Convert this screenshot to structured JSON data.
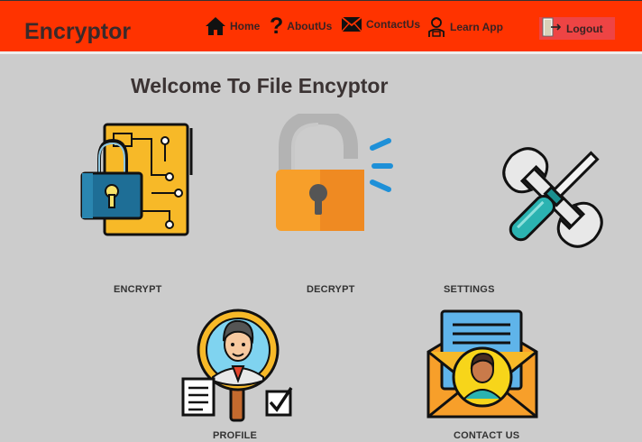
{
  "app": {
    "brand": "Encryptor"
  },
  "nav": [
    {
      "label": "Home",
      "icon": "home-icon"
    },
    {
      "label": "AboutUs",
      "icon": "question-icon"
    },
    {
      "label": "ContactUs",
      "icon": "mail-icon"
    },
    {
      "label": "Learn App",
      "icon": "learner-icon"
    }
  ],
  "logout": {
    "label": "Logout",
    "icon": "exit-door-icon"
  },
  "main": {
    "title": "Welcome To File Encyptor",
    "tiles": [
      {
        "label": "ENCRYPT",
        "icon": "padlock-circuit-icon"
      },
      {
        "label": "DECRYPT",
        "icon": "unlocked-padlock-icon"
      },
      {
        "label": "SETTINGS",
        "icon": "wrench-screwdriver-icon"
      },
      {
        "label": "PROFILE",
        "icon": "profile-magnifier-icon"
      },
      {
        "label": "CONTACT US",
        "icon": "contact-envelope-icon"
      }
    ]
  },
  "colors": {
    "header": "#ff3300",
    "background": "#cccccc",
    "logout": "#ee4444"
  }
}
